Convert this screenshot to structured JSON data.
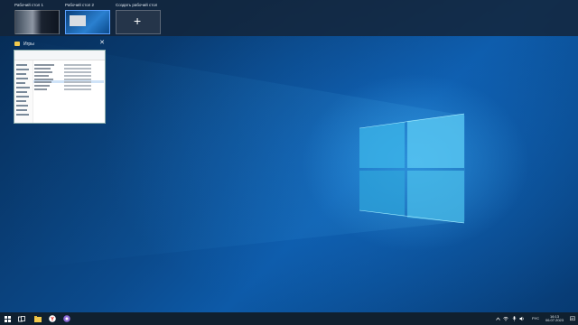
{
  "task_view": {
    "desktops": [
      {
        "label": "Рабочий стол 1"
      },
      {
        "label": "Рабочий стол 2"
      }
    ],
    "new_desktop_label": "Создать рабочий стол",
    "new_desktop_symbol": "+"
  },
  "window_preview": {
    "title": "Игры",
    "close_symbol": "✕"
  },
  "taskbar": {
    "language": "РУС",
    "time": "16:13",
    "date": "06.07.2023"
  },
  "colors": {
    "accent": "#5aa0ff",
    "taskbar": "#10202f",
    "desktop": "#0b4a8c"
  }
}
